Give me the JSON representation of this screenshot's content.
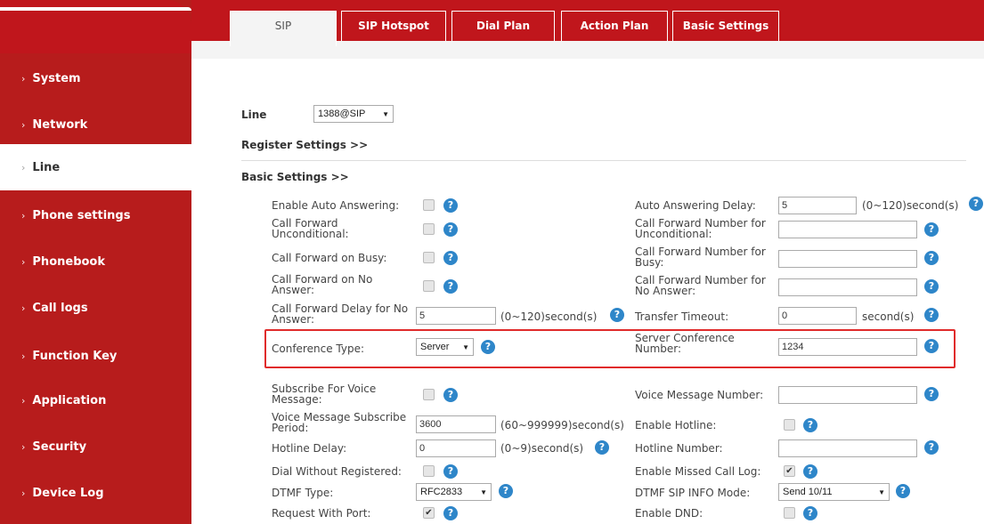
{
  "sidebar": {
    "items": [
      {
        "label": "System"
      },
      {
        "label": "Network"
      },
      {
        "label": "Line"
      },
      {
        "label": "Phone settings"
      },
      {
        "label": "Phonebook"
      },
      {
        "label": "Call logs"
      },
      {
        "label": "Function Key"
      },
      {
        "label": "Application"
      },
      {
        "label": "Security"
      },
      {
        "label": "Device Log"
      }
    ],
    "chevron": "›"
  },
  "tabs": [
    {
      "label": "SIP"
    },
    {
      "label": "SIP Hotspot"
    },
    {
      "label": "Dial Plan"
    },
    {
      "label": "Action Plan"
    },
    {
      "label": "Basic Settings"
    }
  ],
  "line": {
    "label": "Line",
    "value": "1388@SIP"
  },
  "sections": {
    "register": "Register Settings >>",
    "basic": "Basic Settings >>"
  },
  "left": {
    "enable_auto_answering": "Enable Auto Answering:",
    "cf_unconditional": "Call Forward Unconditional:",
    "cf_busy": "Call Forward on Busy:",
    "cf_no_answer": "Call Forward on No Answer:",
    "cf_delay": "Call Forward Delay for No Answer:",
    "cf_delay_value": "5",
    "cf_delay_unit": "(0~120)second(s)",
    "conference_type": "Conference Type:",
    "conference_type_value": "Server",
    "subscribe_vm": "Subscribe For Voice Message:",
    "vm_subscribe_period": "Voice Message Subscribe Period:",
    "vm_subscribe_period_value": "3600",
    "vm_subscribe_period_unit": "(60~999999)second(s)",
    "hotline_delay": "Hotline Delay:",
    "hotline_delay_value": "0",
    "hotline_delay_unit": "(0~9)second(s)",
    "dial_without_registered": "Dial Without Registered:",
    "dtmf_type": "DTMF Type:",
    "dtmf_type_value": "RFC2833",
    "request_with_port": "Request With Port:"
  },
  "right": {
    "auto_answering_delay": "Auto Answering Delay:",
    "auto_answering_delay_value": "5",
    "auto_answering_delay_unit": "(0~120)second(s)",
    "cf_num_unconditional": "Call Forward Number for Unconditional:",
    "cf_num_busy": "Call Forward Number for Busy:",
    "cf_num_no_answer": "Call Forward Number for No Answer:",
    "transfer_timeout": "Transfer Timeout:",
    "transfer_timeout_value": "0",
    "transfer_timeout_unit": "second(s)",
    "server_conf_number": "Server Conference Number:",
    "server_conf_number_value": "1234",
    "voice_message_number": "Voice Message Number:",
    "enable_hotline": "Enable Hotline:",
    "hotline_number": "Hotline Number:",
    "enable_missed_call_log": "Enable Missed Call Log:",
    "dtmf_sip_info_mode": "DTMF SIP INFO Mode:",
    "dtmf_sip_info_mode_value": "Send 10/11",
    "enable_dnd": "Enable DND:"
  },
  "checked": {
    "enable_missed_call_log": true,
    "request_with_port": true
  },
  "check_mark": "✔",
  "help_glyph": "?",
  "dropdown_arrow": "▼",
  "colors": {
    "brand_red": "#c0161c",
    "help_blue": "#2e86c9",
    "highlight": "#e02b2b"
  }
}
